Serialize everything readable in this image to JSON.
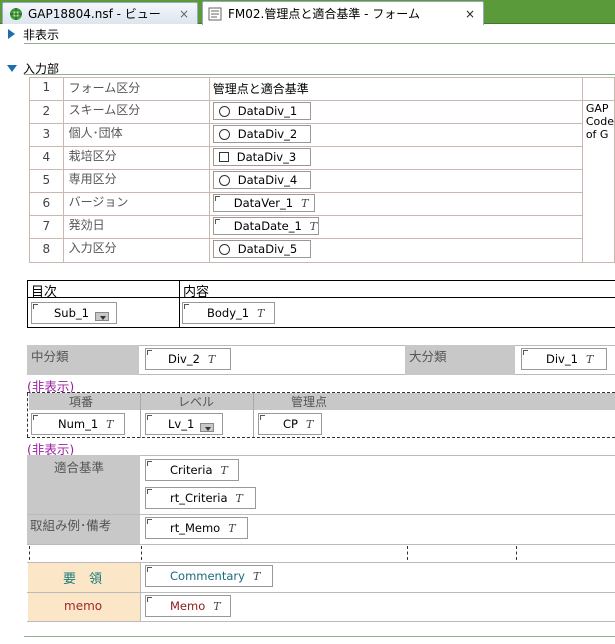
{
  "tabs": [
    {
      "label": "GAP18804.nsf - ビュー",
      "close": "×"
    },
    {
      "label": "FM02.管理点と適合基準 - フォーム",
      "close": "×"
    }
  ],
  "sections": {
    "hidden": "非表示",
    "input": "入力部"
  },
  "form_rows": [
    {
      "num": "1",
      "label": "フォーム区分",
      "value": "管理点と適合基準"
    },
    {
      "num": "2",
      "label": "スキーム区分",
      "field": "DataDiv_1",
      "kind": "radio"
    },
    {
      "num": "3",
      "label": "個人･団体",
      "field": "DataDiv_2",
      "kind": "radio"
    },
    {
      "num": "4",
      "label": "栽培区分",
      "field": "DataDiv_3",
      "kind": "check"
    },
    {
      "num": "5",
      "label": "専用区分",
      "field": "DataDiv_4",
      "kind": "radio"
    },
    {
      "num": "6",
      "label": "バージョン",
      "field": "DataVer_1",
      "kind": "text"
    },
    {
      "num": "7",
      "label": "発効日",
      "field": "DataDate_1",
      "kind": "text"
    },
    {
      "num": "8",
      "label": "入力区分",
      "field": "DataDiv_5",
      "kind": "radio"
    }
  ],
  "side_note": {
    "line1": "GAP",
    "line2": "Code of G"
  },
  "toc": {
    "head1": "目次",
    "head2": "内容",
    "field1": "Sub_1",
    "field2": "Body_1"
  },
  "mid": {
    "label1": "中分類",
    "field1": "Div_2",
    "label2": "大分類",
    "field2": "Div_1"
  },
  "hidden_mark": "(非表示)",
  "cols": {
    "c1": "項番",
    "c2": "レベル",
    "c3": "管理点"
  },
  "col_fields": {
    "f1": "Num_1",
    "f2": "Lv_1",
    "f3": "CP"
  },
  "criteria": {
    "label": "適合基準",
    "field1": "Criteria",
    "field2": "rt_Criteria"
  },
  "memo_row": {
    "label": "取組み例･備考",
    "field": "rt_Memo"
  },
  "commentary": {
    "label": "要　領",
    "field": "Commentary"
  },
  "memo": {
    "label": "memo",
    "field": "Memo"
  },
  "text_badge": "T"
}
